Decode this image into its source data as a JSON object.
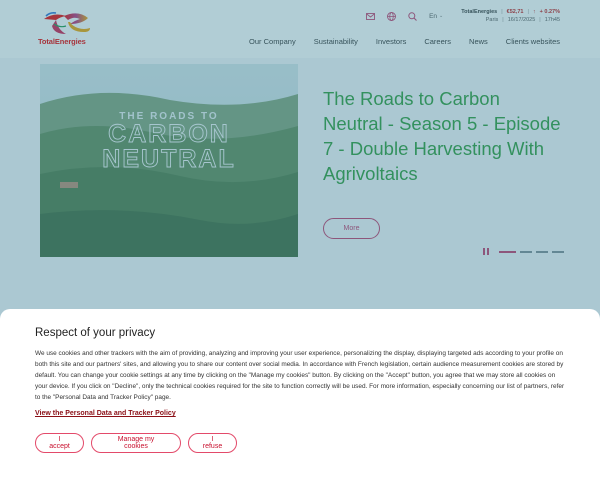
{
  "header": {
    "logo_text": "TotalEnergies",
    "language": "En",
    "stock": {
      "name": "TotalEnergies",
      "price": "€52,71",
      "change": "+ 0.27%",
      "exchange": "Paris",
      "date": "16/17/2025",
      "time": "17h45"
    },
    "nav": [
      "Our Company",
      "Sustainability",
      "Investors",
      "Careers",
      "News",
      "Clients websites"
    ],
    "icons": [
      "mail-icon",
      "globe-icon",
      "search-icon"
    ]
  },
  "hero": {
    "image_text": {
      "line1": "THE ROADS TO",
      "line2": "CARBON",
      "line3": "NEUTRAL"
    },
    "title": "The Roads to Carbon Neutral - Season 5 - Episode 7 - Double Harvesting With Agrivoltaics",
    "more_label": "More",
    "slides_total": 4,
    "active_slide": 1
  },
  "cookie": {
    "title": "Respect of your privacy",
    "body": "We use cookies and other trackers with the aim of providing, analyzing and improving your user experience, personalizing the display, displaying targeted ads according to your profile on both this site and our partners' sites, and allowing you to share our content over social media. In accordance with French legislation, certain audience measurement cookies are stored by default. You can change your cookie settings at any time by clicking on the \"Manage my cookies\" button. By clicking on the \"Accept\" button, you agree that we may store all cookies on your device. If you click on \"Decline\", only the technical cookies required for the site to function correctly will be used. For more information, especially concerning our list of partners, refer to the \"Personal Data and Tracker Policy\" page.",
    "policy_link": "View the Personal Data and Tracker Policy",
    "accept_label": "I accept",
    "manage_label": "Manage my cookies",
    "refuse_label": "I refuse"
  },
  "colors": {
    "brand_red": "#ed0000",
    "title_green": "#2e9b3a",
    "accent": "#c43a6a"
  }
}
